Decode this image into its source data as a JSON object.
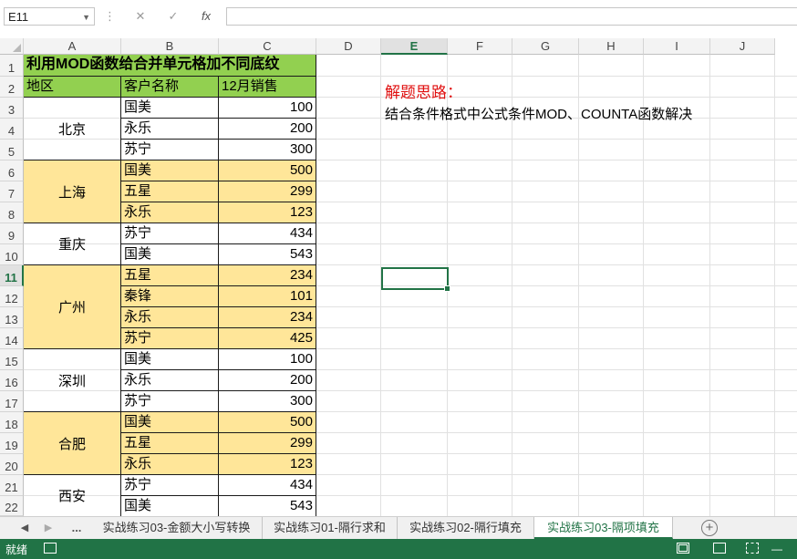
{
  "formula_bar": {
    "name_box": "E11",
    "cancel": "✕",
    "enter": "✓",
    "fx": "fx",
    "formula": ""
  },
  "columns": [
    "A",
    "B",
    "C",
    "D",
    "E",
    "F",
    "G",
    "H",
    "I",
    "J"
  ],
  "rows": [
    "1",
    "2",
    "3",
    "4",
    "5",
    "6",
    "7",
    "8",
    "9",
    "10",
    "11",
    "12",
    "13",
    "14",
    "15",
    "16",
    "17",
    "18",
    "19",
    "20",
    "21",
    "22"
  ],
  "selected": {
    "column": "E",
    "row": "11"
  },
  "table": {
    "title": "利用MOD函数给合并单元格加不同底纹",
    "headers": [
      "地区",
      "客户名称",
      "12月销售"
    ],
    "groups": [
      {
        "region": "北京",
        "items": [
          {
            "customer": "国美",
            "sales": "100"
          },
          {
            "customer": "永乐",
            "sales": "200"
          },
          {
            "customer": "苏宁",
            "sales": "300"
          }
        ]
      },
      {
        "region": "上海",
        "items": [
          {
            "customer": "国美",
            "sales": "500"
          },
          {
            "customer": "五星",
            "sales": "299"
          },
          {
            "customer": "永乐",
            "sales": "123"
          }
        ]
      },
      {
        "region": "重庆",
        "items": [
          {
            "customer": "苏宁",
            "sales": "434"
          },
          {
            "customer": "国美",
            "sales": "543"
          }
        ]
      },
      {
        "region": "广州",
        "items": [
          {
            "customer": "五星",
            "sales": "234"
          },
          {
            "customer": "秦锋",
            "sales": "101"
          },
          {
            "customer": "永乐",
            "sales": "234"
          },
          {
            "customer": "苏宁",
            "sales": "425"
          }
        ]
      },
      {
        "region": "深圳",
        "items": [
          {
            "customer": "国美",
            "sales": "100"
          },
          {
            "customer": "永乐",
            "sales": "200"
          },
          {
            "customer": "苏宁",
            "sales": "300"
          }
        ]
      },
      {
        "region": "合肥",
        "items": [
          {
            "customer": "国美",
            "sales": "500"
          },
          {
            "customer": "五星",
            "sales": "299"
          },
          {
            "customer": "永乐",
            "sales": "123"
          }
        ]
      },
      {
        "region": "西安",
        "items": [
          {
            "customer": "苏宁",
            "sales": "434"
          },
          {
            "customer": "国美",
            "sales": "543"
          }
        ]
      }
    ]
  },
  "note": {
    "title": "解题思路：",
    "body": "结合条件格式中公式条件MOD、COUNTA函数解决"
  },
  "sheet_tabs": {
    "more": "...",
    "tabs": [
      "实战练习03-金额大小写转换",
      "实战练习01-隔行求和",
      "实战练习02-隔行填充",
      "实战练习03-隔项填充"
    ],
    "active_index": 3,
    "add": "+"
  },
  "status": {
    "text": "就绪"
  },
  "colors": {
    "header_green": "#92d050",
    "band_yellow": "#ffe699",
    "excel_green": "#217346",
    "note_red": "#e01010"
  }
}
